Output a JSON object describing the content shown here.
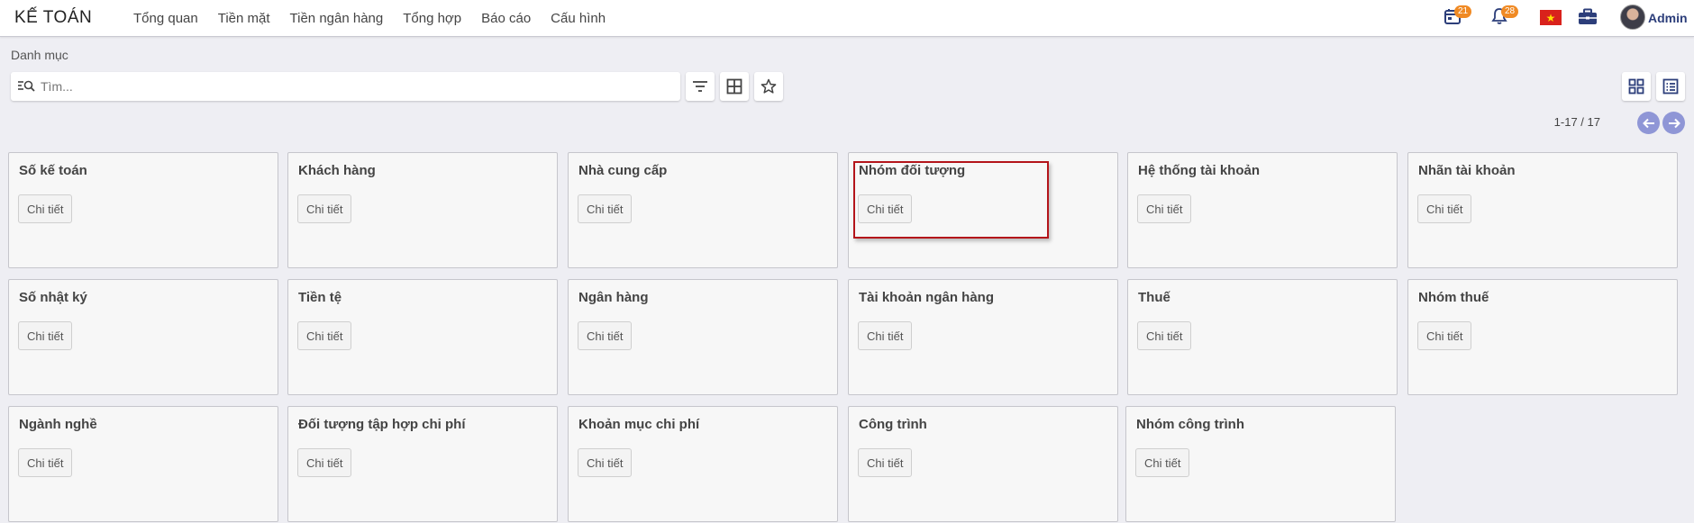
{
  "app": {
    "title": "KẾ TOÁN"
  },
  "nav": [
    {
      "label": "Tổng quan"
    },
    {
      "label": "Tiền mặt"
    },
    {
      "label": "Tiền ngân hàng"
    },
    {
      "label": "Tổng hợp"
    },
    {
      "label": "Báo cáo"
    },
    {
      "label": "Cấu hình"
    }
  ],
  "header": {
    "calendar_badge": "21",
    "bell_badge": "28",
    "user_name": "Admin"
  },
  "breadcrumb": "Danh mục",
  "search": {
    "placeholder": "Tìm...",
    "value": ""
  },
  "pager": {
    "text": "1-17 / 17"
  },
  "cards": [
    {
      "title": "Số kế toán",
      "button": "Chi tiết"
    },
    {
      "title": "Khách hàng",
      "button": "Chi tiết"
    },
    {
      "title": "Nhà cung cấp",
      "button": "Chi tiết"
    },
    {
      "title": "Nhóm đối tượng",
      "button": "Chi tiết"
    },
    {
      "title": "Hệ thống tài khoản",
      "button": "Chi tiết"
    },
    {
      "title": "Nhãn tài khoản",
      "button": "Chi tiết"
    },
    {
      "title": "Số nhật ký",
      "button": "Chi tiết"
    },
    {
      "title": "Tiền tệ",
      "button": "Chi tiết"
    },
    {
      "title": "Ngân hàng",
      "button": "Chi tiết"
    },
    {
      "title": "Tài khoản ngân hàng",
      "button": "Chi tiết"
    },
    {
      "title": "Thuế",
      "button": "Chi tiết"
    },
    {
      "title": "Nhóm thuế",
      "button": "Chi tiết"
    },
    {
      "title": "Ngành nghề",
      "button": "Chi tiết"
    },
    {
      "title": "Đối tượng tập hợp chi phí",
      "button": "Chi tiết"
    },
    {
      "title": "Khoản mục chi phí",
      "button": "Chi tiết"
    },
    {
      "title": "Công trình",
      "button": "Chi tiết"
    },
    {
      "title": "Nhóm công trình",
      "button": "Chi tiết"
    }
  ],
  "colors": {
    "accent": "#2c3e7a",
    "badge": "#f08a24",
    "pager": "#8f96d6",
    "highlight": "#b4141a"
  }
}
